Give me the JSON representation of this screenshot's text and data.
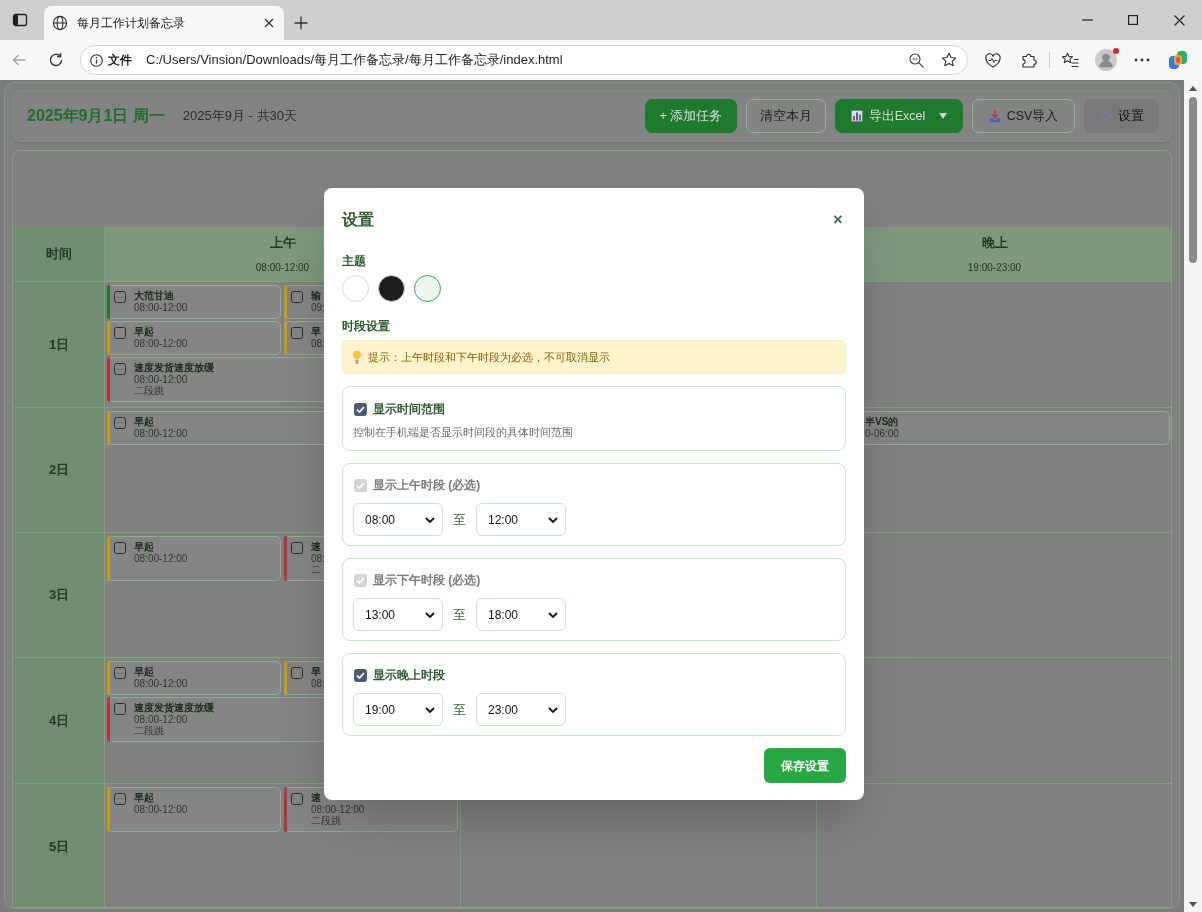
{
  "browser": {
    "tab_title": "每月工作计划备忘录",
    "scheme": "文件",
    "url": "C:/Users/Vinsion/Downloads/每月工作备忘录/每月工作备忘录/index.html"
  },
  "header": {
    "date": "2025年9月1日 周一",
    "summary": "2025年9月 - 共30天",
    "buttons": [
      {
        "label": "+ 添加任务",
        "kind": "add"
      },
      {
        "label": "清空本月",
        "kind": "clear"
      },
      {
        "label": "导出Excel",
        "kind": "export"
      },
      {
        "label": "CSV导入",
        "kind": "import"
      },
      {
        "label": "设置",
        "kind": "settings"
      }
    ]
  },
  "table": {
    "columns": [
      {
        "label": "时间"
      },
      {
        "label": "上午",
        "range": "08:00-12:00"
      },
      {
        "label": "晚上",
        "range": "19:00-23:00"
      }
    ],
    "rows": [
      {
        "day": "1日",
        "morning": [
          {
            "title": "大范甘迪",
            "time": "08:00-12:00",
            "checked": false,
            "color": "#1f7a2c"
          },
          {
            "title": "输",
            "time": "09:",
            "checked": false,
            "color": "#c99a12"
          },
          {
            "title": "早起",
            "time": "08:00-12:00",
            "checked": false,
            "color": "#c99a12"
          },
          {
            "title": "早",
            "time": "08:",
            "checked": false,
            "color": "#c99a12"
          },
          {
            "title": "速度发货速度放缓",
            "time": "08:00-12:00",
            "note": "二段跳",
            "checked": false,
            "color": "#b8333a"
          }
        ]
      },
      {
        "day": "2日",
        "morning": [
          {
            "title": "早起",
            "time": "08:00-12:00",
            "checked": false,
            "color": "#c99a12"
          }
        ],
        "evening": [
          {
            "title": "半VS的",
            "time": "0-06:00"
          }
        ]
      },
      {
        "day": "3日",
        "morning": [
          {
            "title": "早起",
            "time": "08:00-12:00",
            "checked": false,
            "color": "#c99a12"
          },
          {
            "title": "速",
            "time": "08:",
            "note": "二",
            "checked": false,
            "color": "#b8333a"
          }
        ]
      },
      {
        "day": "4日",
        "morning": [
          {
            "title": "早起",
            "time": "08:00-12:00",
            "checked": false,
            "color": "#c99a12"
          },
          {
            "title": "早",
            "time": "08:",
            "checked": false,
            "color": "#c99a12"
          },
          {
            "title": "速度发货速度放缓",
            "time": "08:00-12:00",
            "note": "二段跳",
            "checked": false,
            "color": "#b8333a"
          }
        ]
      },
      {
        "day": "5日",
        "morning": [
          {
            "title": "早起",
            "time": "08:00-12:00",
            "checked": false,
            "color": "#c99a12"
          },
          {
            "title": "速",
            "time": "08:00-12:00",
            "note": "二段跳",
            "checked": false,
            "color": "#b8333a"
          }
        ]
      }
    ]
  },
  "settings_dialog": {
    "title": "设置",
    "close": "×",
    "theme_label": "主题",
    "themes": [
      {
        "color": "#ffffff",
        "selected": false
      },
      {
        "color": "#1e1e1e",
        "selected": false
      },
      {
        "color": "#eef7ee",
        "selected": true
      }
    ],
    "periods_label": "时段设置",
    "tip": "提示：上午时段和下午时段为必选，不可取消显示",
    "options": [
      {
        "kind": "toggle",
        "label": "显示时间范围",
        "checked": true,
        "disabled": false,
        "description": "控制在手机端是否显示时间段的具体时间范围"
      },
      {
        "kind": "range",
        "label": "显示上午时段 (必选)",
        "checked": true,
        "disabled": true,
        "from": "08:00",
        "separator": "至",
        "to": "12:00"
      },
      {
        "kind": "range",
        "label": "显示下午时段 (必选)",
        "checked": true,
        "disabled": true,
        "from": "13:00",
        "separator": "至",
        "to": "18:00"
      },
      {
        "kind": "range",
        "label": "显示晚上时段",
        "checked": true,
        "disabled": false,
        "from": "19:00",
        "separator": "至",
        "to": "23:00"
      }
    ],
    "save": "保存设置"
  }
}
